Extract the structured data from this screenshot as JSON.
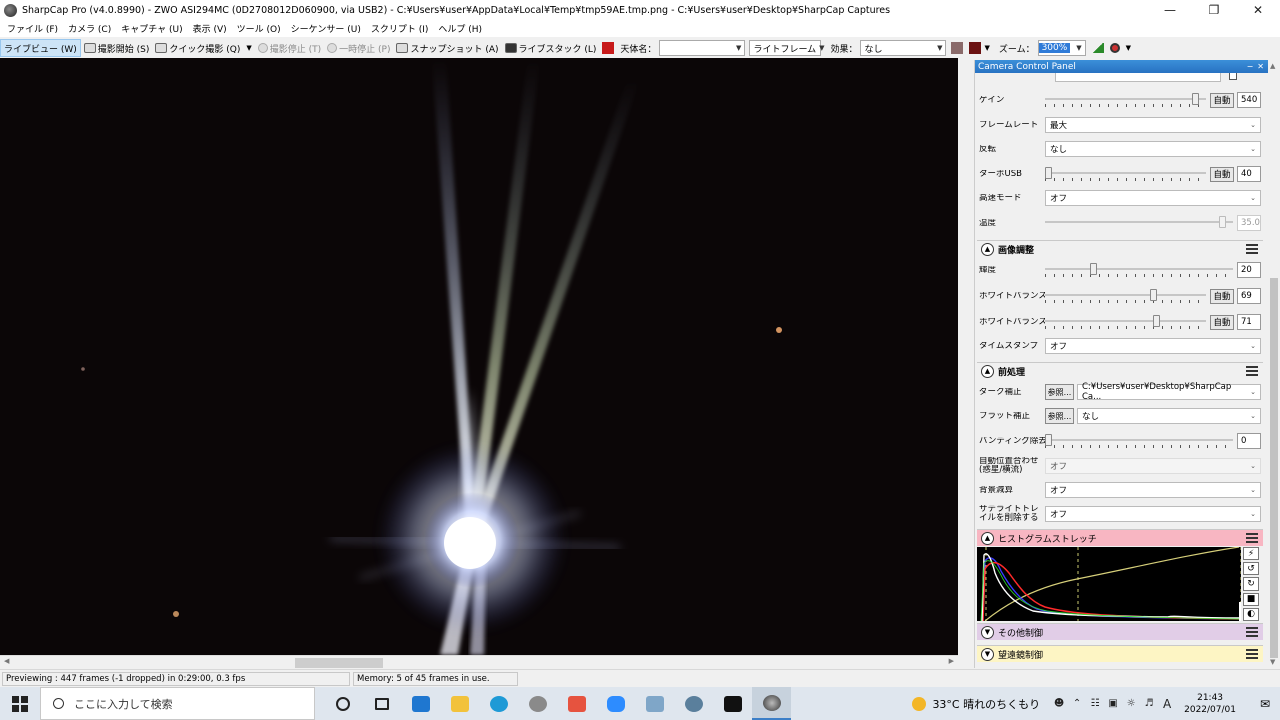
{
  "window": {
    "title": "SharpCap Pro (v4.0.8990) - ZWO ASI294MC (0D2708012D060900, via USB2) - C:¥Users¥user¥AppData¥Local¥Temp¥tmp59AE.tmp.png - C:¥Users¥user¥Desktop¥SharpCap Captures"
  },
  "menu": [
    "ファイル (F)",
    "カメラ (C)",
    "キャプチャ (U)",
    "表示 (V)",
    "ツール (O)",
    "シーケンサー (U)",
    "スクリプト (I)",
    "ヘルプ (H)"
  ],
  "toolbar": {
    "live_view": "ライブビュー (W)",
    "start_capture": "撮影開始 (S)",
    "quick_capture": "クイック撮影 (Q)",
    "stop_capture": "撮影停止 (T)",
    "pause": "一時停止 (P)",
    "snapshot": "スナップショット (A)",
    "live_stack": "ライブスタック (L)",
    "object_name_label": "天体名：",
    "object_name_value": "",
    "frame_type": "ライトフレーム",
    "effect_label": "効果：",
    "effect_value": "なし",
    "zoom_label": "ズーム：",
    "zoom_value": "300%",
    "red_accent": "#c71a1a",
    "swatch_1": "#8a6a6a",
    "swatch_2": "#6b1212"
  },
  "panel": {
    "title": "Camera Control Panel",
    "camera": {
      "gain": {
        "label": "ゲイン",
        "auto": "自動",
        "value": "540",
        "level": 0.955
      },
      "frame_rate": {
        "label": "フレームレート",
        "value": "最大"
      },
      "flip": {
        "label": "反転",
        "value": "なし"
      },
      "turbo_usb": {
        "label": "ターボUSB",
        "auto": "自動",
        "value": "40",
        "level": 0.0
      },
      "high_speed": {
        "label": "高速モード",
        "value": "オフ"
      },
      "temperature": {
        "label": "温度",
        "value": "35.0",
        "level": 0.96
      }
    },
    "image_adjust": {
      "title": "画像調整",
      "contrast": {
        "label": "輝度",
        "value": "20",
        "level": 0.25
      },
      "wb_red": {
        "label": "ホワイトバランス(R)",
        "auto": "自動",
        "value": "69",
        "level": 0.68
      },
      "wb_blue": {
        "label": "ホワイトバランス(B)",
        "auto": "自動",
        "value": "71",
        "level": 0.7
      },
      "timestamp": {
        "label": "タイムスタンプ",
        "value": "オフ"
      }
    },
    "preprocess": {
      "title": "前処理",
      "dark": {
        "label": "ダーク補正",
        "browse": "参照...",
        "value": "C:¥Users¥user¥Desktop¥SharpCap Ca..."
      },
      "flat": {
        "label": "フラット補正",
        "browse": "参照...",
        "value": "なし"
      },
      "banding": {
        "label": "バンディング除去",
        "value": "0",
        "level": 0.0
      },
      "auto_align": {
        "label": "自動位置合わせ(惑星/横流)",
        "value": "オフ"
      },
      "background": {
        "label": "背景減算",
        "value": "オフ"
      },
      "satellite": {
        "label": "サテライトトレイルを削除する",
        "value": "オフ"
      }
    },
    "histogram": {
      "title": "ヒストグラムストレッチ",
      "bg": "#f8b6c2"
    },
    "other": {
      "title": "その他制御",
      "bg": "#e1cde7"
    },
    "telescope": {
      "title": "望遠鏡制御",
      "bg": "#fdf5c4"
    }
  },
  "status": {
    "preview": "Previewing : 447 frames (-1 dropped) in 0:29:00, 0.3 fps",
    "memory": "Memory: 5 of 45 frames in use."
  },
  "taskbar": {
    "search_placeholder": "ここに入力して検索",
    "weather": "33°C  晴れのちくもり",
    "time": "21:43",
    "date": "2022/07/01",
    "ime": "A"
  }
}
